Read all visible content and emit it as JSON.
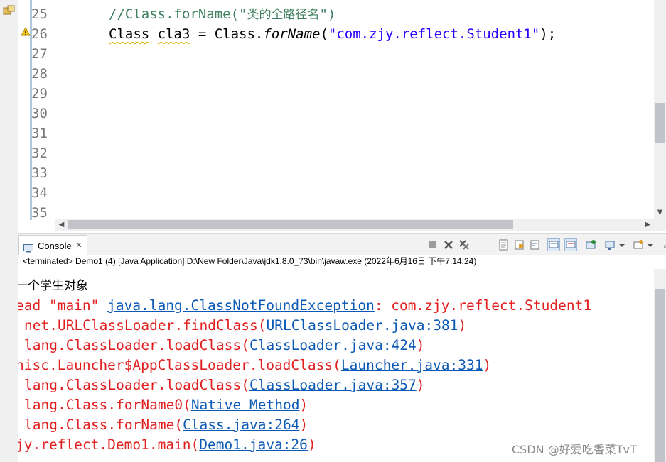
{
  "editor": {
    "lines": [
      {
        "num": "25",
        "comment_prefix": "//Class.forName(\"",
        "comment_cjk": "类的全路径名",
        "comment_suffix": "\")"
      },
      {
        "num": "26",
        "kw": "Class",
        "var": "cla3",
        "mid1": " = Class.",
        "method": "forName",
        "paren": "(",
        "str": "\"com.zjy.reflect.Student1\"",
        "tail": ");"
      },
      {
        "num": "27"
      },
      {
        "num": "28"
      },
      {
        "num": "29"
      },
      {
        "num": "30"
      },
      {
        "num": "31"
      },
      {
        "num": "32"
      },
      {
        "num": "33"
      },
      {
        "num": "34"
      },
      {
        "num": "35"
      }
    ]
  },
  "console": {
    "tab_label": "Console",
    "status": "<terminated> Demo1 (4) [Java Application] D:\\New Folder\\Java\\jdk1.8.0_73\\bin\\javaw.exe (2022年6月16日 下午7:14:24)",
    "output": [
      {
        "plain": "一个学生对象"
      },
      {
        "pre": "ead \"main\" ",
        "link": "java.lang.ClassNotFoundException",
        "post": ": com.zjy.reflect.Student1"
      },
      {
        "pre": "net.URLClassLoader.findClass(",
        "link": "URLClassLoader.java:381",
        "post": ")"
      },
      {
        "pre": "lang.ClassLoader.loadClass(",
        "link": "ClassLoader.java:424",
        "post": ")"
      },
      {
        "pre": "nisc.Launcher$AppClassLoader.loadClass(",
        "link": "Launcher.java:331",
        "post": ")"
      },
      {
        "pre": "lang.ClassLoader.loadClass(",
        "link": "ClassLoader.java:357",
        "post": ")"
      },
      {
        "pre": "lang.Class.forName0(",
        "link": "Native Method",
        "post": ")"
      },
      {
        "pre": "lang.Class.forName(",
        "link": "Class.java:264",
        "post": ")"
      },
      {
        "pre": "jy.reflect.Demo1.main(",
        "link": "Demo1.java:26",
        "post": ")"
      }
    ]
  },
  "watermark": "CSDN @好爱吃香菜TvT",
  "colors": {
    "comment": "#3f7f5f",
    "string": "#2a00ff",
    "error": "#e21f1f",
    "link": "#0b59b5"
  }
}
